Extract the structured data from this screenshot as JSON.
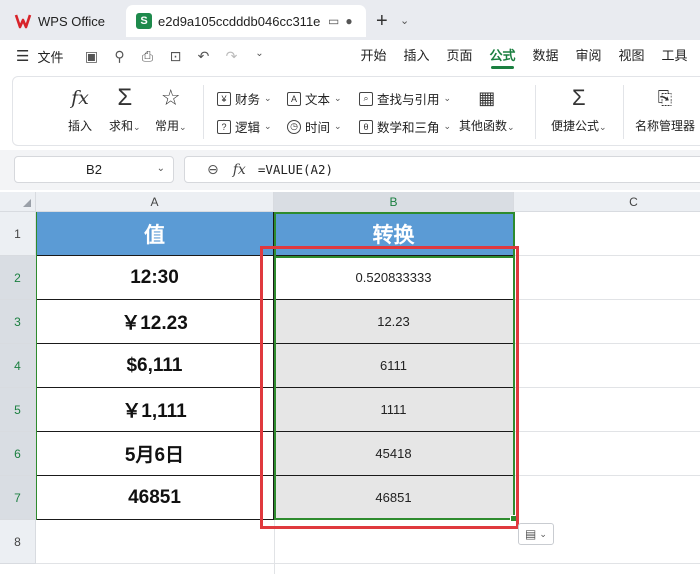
{
  "titlebar": {
    "app_name": "WPS Office",
    "doc_tab": "e2d9a105ccdddb046cc311e",
    "doc_icon_letter": "S"
  },
  "menubar": {
    "file_label": "文件",
    "tabs": [
      "开始",
      "插入",
      "页面",
      "公式",
      "数据",
      "审阅",
      "视图",
      "工具"
    ],
    "active_tab": "公式"
  },
  "ribbon": {
    "insert_label": "插入",
    "sum_label": "求和",
    "common_label": "常用",
    "finance_label": "财务",
    "text_label": "文本",
    "lookup_label": "查找与引用",
    "logic_label": "逻辑",
    "time_label": "时间",
    "math_label": "数学和三角",
    "other_label": "其他函数",
    "quick_formula_label": "便捷公式",
    "name_manager_label": "名称管理器"
  },
  "formula_bar": {
    "cell_ref": "B2",
    "formula": "=VALUE(A2)"
  },
  "grid": {
    "columns": [
      "A",
      "B",
      "C"
    ],
    "rows": [
      "1",
      "2",
      "3",
      "4",
      "5",
      "6",
      "7",
      "8"
    ],
    "header_a": "值",
    "header_b": "转换",
    "a_values": [
      "12:30",
      "￥12.23",
      "$6,111",
      "￥1,111",
      "5月6日",
      "46851"
    ],
    "b_values": [
      "0.520833333",
      "12.23",
      "6111",
      "1111",
      "45418",
      "46851"
    ]
  },
  "colors": {
    "header_fill": "#5b9bd5",
    "selection_border": "#2e8b2e",
    "annotation_red": "#e0393e",
    "active_tab": "#1b7f40"
  }
}
